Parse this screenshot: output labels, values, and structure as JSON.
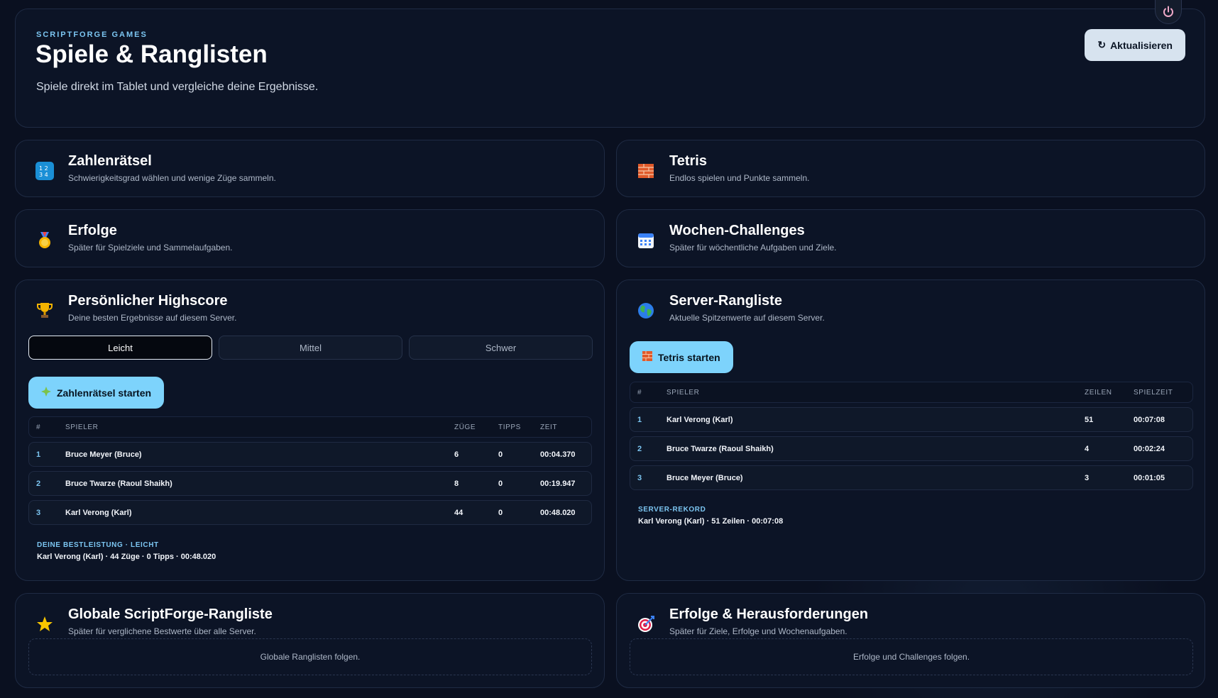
{
  "header": {
    "eyebrow": "SCRIPTFORGE GAMES",
    "title": "Spiele & Ranglisten",
    "subtitle": "Spiele direkt im Tablet und vergleiche deine Ergebnisse.",
    "refresh_icon": "↻",
    "refresh_label": "Aktualisieren"
  },
  "cards": {
    "numbers": {
      "icon": "numbers-icon",
      "title": "Zahlenrätsel",
      "desc": "Schwierigkeitsgrad wählen und wenige Züge sammeln."
    },
    "tetris": {
      "icon": "brick-icon",
      "title": "Tetris",
      "desc": "Endlos spielen und Punkte sammeln."
    },
    "achievements": {
      "icon": "medal-icon",
      "title": "Erfolge",
      "desc": "Später für Spielziele und Sammelaufgaben."
    },
    "weekly": {
      "icon": "calendar-icon",
      "title": "Wochen-Challenges",
      "desc": "Später für wöchentliche Aufgaben und Ziele."
    }
  },
  "personal": {
    "icon": "trophy-icon",
    "title": "Persönlicher Highscore",
    "desc": "Deine besten Ergebnisse auf diesem Server.",
    "tabs": [
      "Leicht",
      "Mittel",
      "Schwer"
    ],
    "active_tab": "Leicht",
    "start_label": "Zahlenrätsel starten",
    "columns": {
      "rank": "#",
      "player": "SPIELER",
      "moves": "ZÜGE",
      "tips": "TIPPS",
      "time": "ZEIT"
    },
    "rows": [
      {
        "rank": "1",
        "player": "Bruce Meyer (Bruce)",
        "moves": "6",
        "tips": "0",
        "time": "00:04.370"
      },
      {
        "rank": "2",
        "player": "Bruce Twarze (Raoul Shaikh)",
        "moves": "8",
        "tips": "0",
        "time": "00:19.947"
      },
      {
        "rank": "3",
        "player": "Karl Verong (Karl)",
        "moves": "44",
        "tips": "0",
        "time": "00:48.020"
      }
    ],
    "best_label": "DEINE BESTLEISTUNG · LEICHT",
    "best_text": "Karl Verong (Karl) · 44 Züge · 0 Tipps · 00:48.020"
  },
  "server": {
    "icon": "globe-icon",
    "title": "Server-Rangliste",
    "desc": "Aktuelle Spitzenwerte auf diesem Server.",
    "start_label": "Tetris starten",
    "columns": {
      "rank": "#",
      "player": "SPIELER",
      "lines": "ZEILEN",
      "time": "SPIELZEIT"
    },
    "rows": [
      {
        "rank": "1",
        "player": "Karl Verong (Karl)",
        "lines": "51",
        "time": "00:07:08"
      },
      {
        "rank": "2",
        "player": "Bruce Twarze (Raoul Shaikh)",
        "lines": "4",
        "time": "00:02:24"
      },
      {
        "rank": "3",
        "player": "Bruce Meyer (Bruce)",
        "lines": "3",
        "time": "00:01:05"
      }
    ],
    "record_label": "SERVER-REKORD",
    "record_text": "Karl Verong (Karl) · 51 Zeilen · 00:07:08"
  },
  "global": {
    "icon": "star-icon",
    "title": "Globale ScriptForge-Rangliste",
    "desc": "Später für verglichene Bestwerte über alle Server.",
    "placeholder": "Globale Ranglisten folgen."
  },
  "challenges": {
    "icon": "target-icon",
    "title": "Erfolge & Herausforderungen",
    "desc": "Später für Ziele, Erfolge und Wochenaufgaben.",
    "placeholder": "Erfolge und Challenges folgen."
  },
  "colors": {
    "background": "#0a1020",
    "card": "#0c1426",
    "accent": "#7dd3fc",
    "rank": "#7cc6f2"
  }
}
